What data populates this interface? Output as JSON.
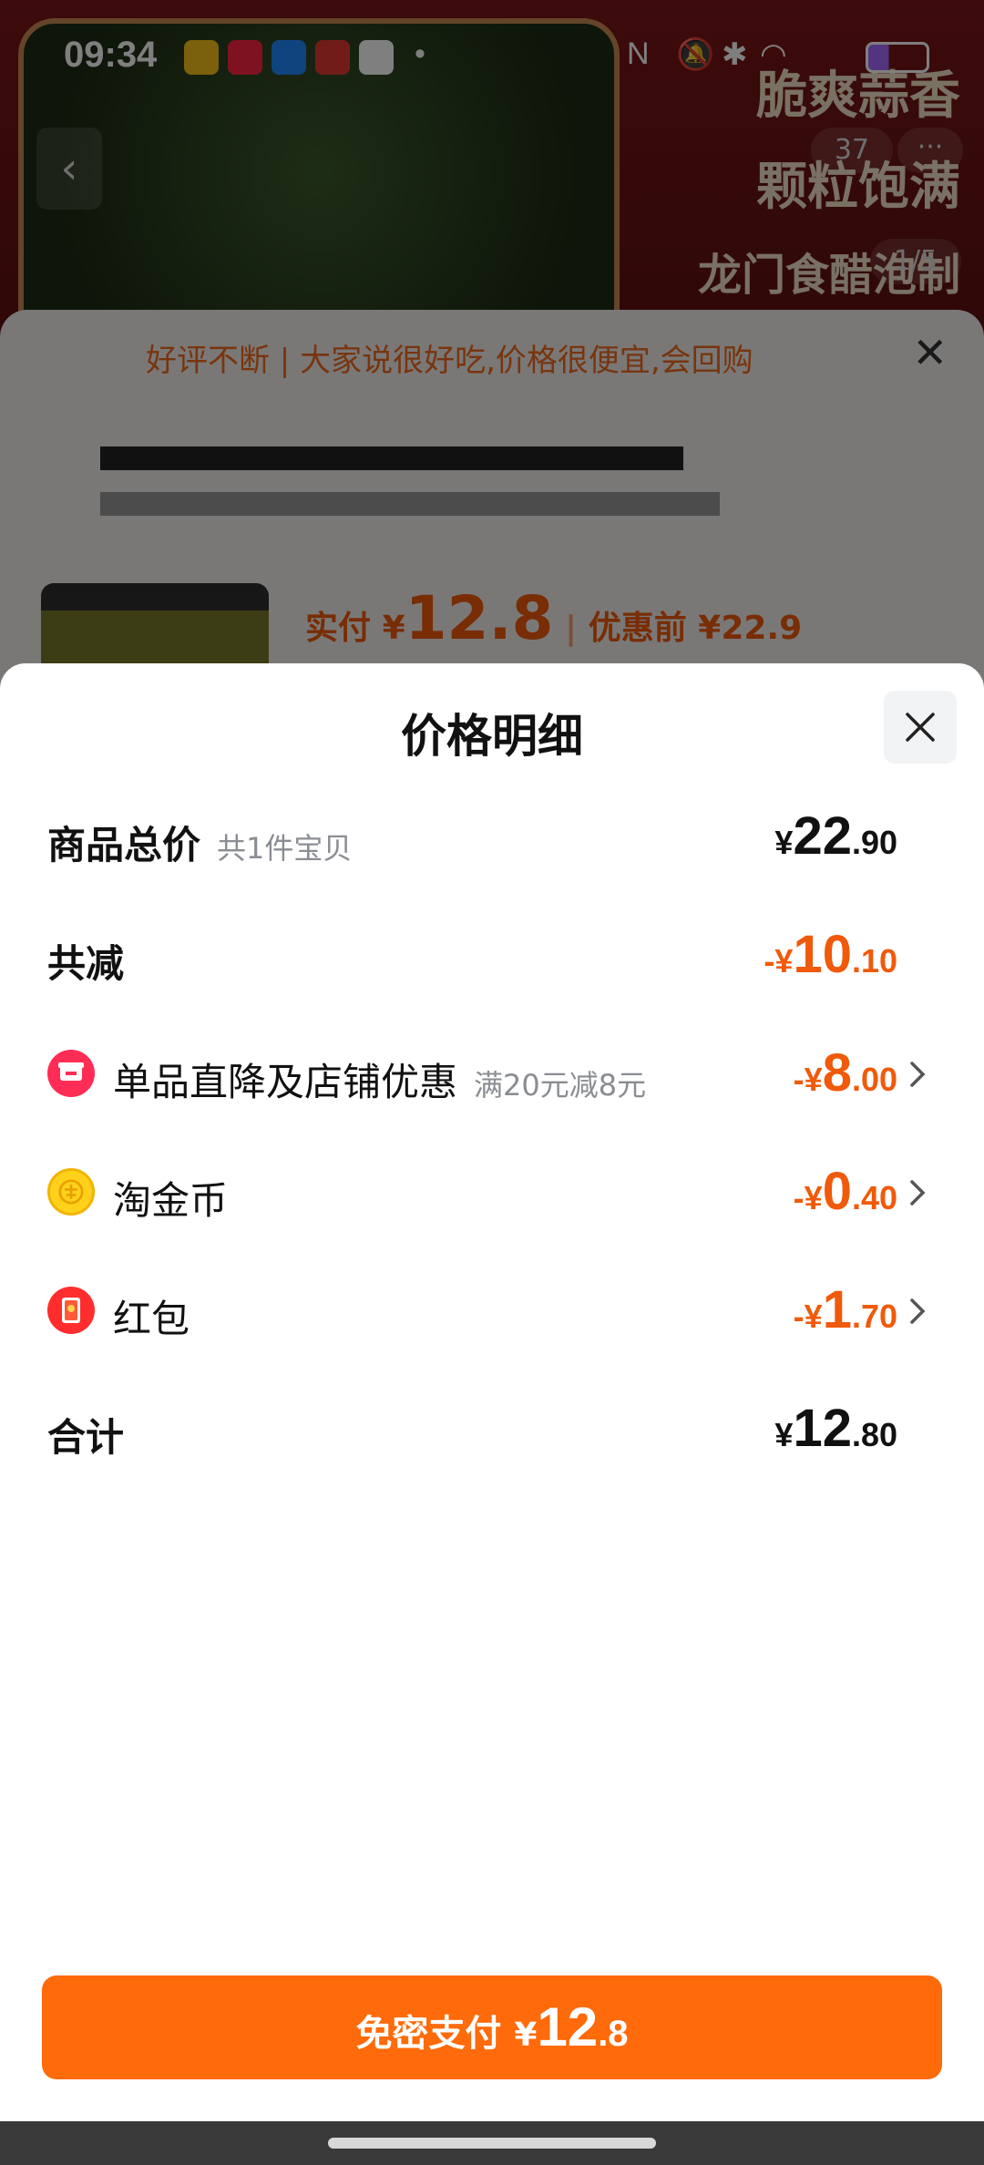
{
  "status_bar": {
    "time": "09:34",
    "app_icons": [
      "weibo-icon",
      "xiaohongshu-icon",
      "dingtalk-icon",
      "music-icon",
      "messenger-icon"
    ],
    "system_icons": [
      "nfc-icon",
      "mute-icon",
      "bluetooth-icon",
      "wifi-icon",
      "battery-charging-icon"
    ]
  },
  "background": {
    "promo_lines": [
      "脆爽蒜香",
      "颗粒饱满",
      "龙门食醋泡制"
    ],
    "image_counter": "1/5",
    "cart_count": "37",
    "review_banner": "好评不断 | 大家说很好吃,价格很便宜,会回购",
    "payment_summary": {
      "paid_label": "实付",
      "paid_currency": "¥",
      "paid_amount": "12.8",
      "before_label": "优惠前",
      "before_amount": "¥22.9"
    }
  },
  "sheet": {
    "title": "价格明细",
    "rows": [
      {
        "label": "商品总价",
        "sub": "共1件宝贝",
        "currency": "¥",
        "integer": "22",
        "decimal": ".90",
        "accent": "dark"
      },
      {
        "label": "共减",
        "currency": "-¥",
        "integer": "10",
        "decimal": ".10",
        "accent": "orange"
      },
      {
        "label": "单品直降及店铺优惠",
        "sub": "满20元减8元",
        "icon": "shop-discount-icon",
        "currency": "-¥",
        "integer": "8",
        "decimal": ".00",
        "accent": "orange"
      },
      {
        "label": "淘金币",
        "icon": "gold-coin-icon",
        "currency": "-¥",
        "integer": "0",
        "decimal": ".40",
        "accent": "orange"
      },
      {
        "label": "红包",
        "icon": "red-envelope-icon",
        "currency": "-¥",
        "integer": "1",
        "decimal": ".70",
        "accent": "orange"
      },
      {
        "label": "合计",
        "currency": "¥",
        "integer": "12",
        "decimal": ".80",
        "accent": "dark"
      }
    ]
  },
  "pay_button": {
    "label": "免密支付",
    "currency": "¥",
    "integer": "12",
    "decimal": ".8"
  },
  "colors": {
    "accent_orange": "#f05a0a",
    "button_orange": "#ff6a0a",
    "text_dark": "#111111",
    "text_muted": "#8a8d93"
  }
}
